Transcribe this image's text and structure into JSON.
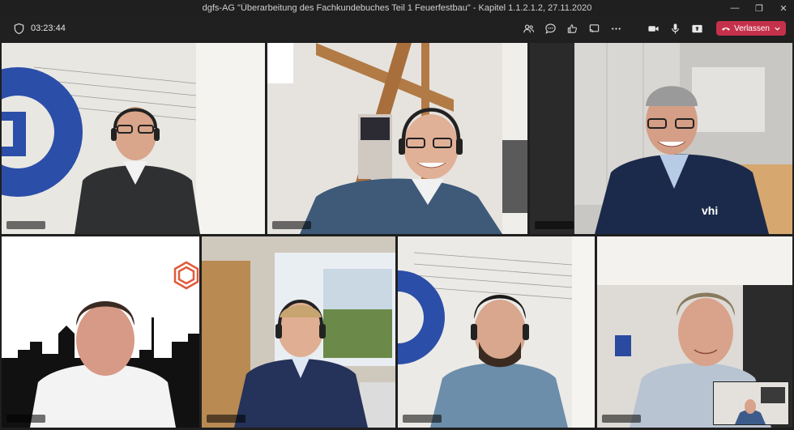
{
  "window": {
    "title": "dgfs-AG \"Überarbeitung des Fachkundebuches Teil 1 Feuerfestbau\" - Kapitel 1.1.2.1.2, 27.11.2020",
    "minimize_glyph": "—",
    "restore_glyph": "❐",
    "close_glyph": "✕"
  },
  "meeting": {
    "timer": "03:23:44",
    "leave_label": "Verlassen",
    "leave_color": "#c4314b",
    "active_speaker_color": "#7f85f5"
  },
  "toolbar_icons": [
    "people-icon",
    "chat-icon",
    "reactions-icon",
    "share-tray-icon",
    "more-icon",
    "camera-icon",
    "mic-icon",
    "share-icon"
  ]
}
